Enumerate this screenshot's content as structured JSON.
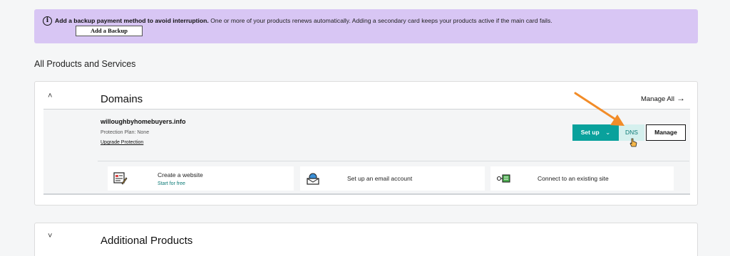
{
  "banner": {
    "bold_text": "Add a backup payment method to avoid interruption.",
    "text": " One or more of your products renews automatically. Adding a secondary card keeps your products active if the main card fails.",
    "button_label": "Add a Backup"
  },
  "section_title": "All Products and Services",
  "domains_card": {
    "title": "Domains",
    "manage_all": "Manage All",
    "domain": {
      "name": "willoughbyhomebuyers.info",
      "protection": "Protection Plan: None",
      "upgrade_link": "Upgrade Protection"
    },
    "buttons": {
      "setup": "Set up",
      "dns": "DNS",
      "manage": "Manage"
    },
    "tiles": [
      {
        "label": "Create a website",
        "sub": "Start for free",
        "icon": "website-builder-icon"
      },
      {
        "label": "Set up an email account",
        "icon": "email-icon"
      },
      {
        "label": "Connect to an existing site",
        "icon": "connect-site-icon"
      }
    ]
  },
  "additional_card": {
    "title": "Additional Products"
  },
  "colors": {
    "banner_bg": "#d8c6f4",
    "primary_teal": "#09a19c",
    "dns_bg": "#d5f0ee",
    "annotation_arrow": "#f28c28"
  }
}
